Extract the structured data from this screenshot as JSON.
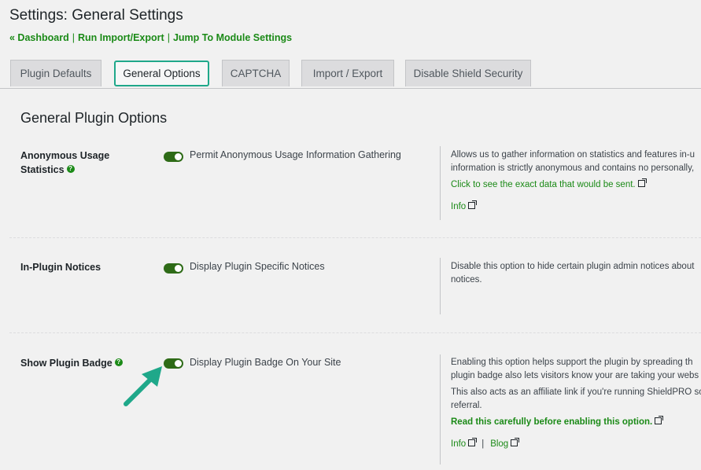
{
  "header": {
    "title": "Settings: General Settings",
    "links": [
      "« Dashboard",
      "Run Import/Export",
      "Jump To Module Settings"
    ],
    "link_sep": "|"
  },
  "tabs": [
    {
      "label": "Plugin Defaults",
      "active": false
    },
    {
      "label": "General Options",
      "active": true
    },
    {
      "label": "CAPTCHA",
      "active": false
    },
    {
      "label": "Import / Export",
      "active": false
    },
    {
      "label": "Disable Shield Security",
      "active": false
    }
  ],
  "section": {
    "title": "General Plugin Options"
  },
  "options": [
    {
      "label_line1": "Anonymous Usage",
      "label_line2": "Statistics",
      "has_help": true,
      "toggle_label": "Permit Anonymous Usage Information Gathering",
      "enabled": true,
      "desc_lines": [
        "Allows us to gather information on statistics and features in-u",
        "information is strictly anonymous and contains no personally,"
      ],
      "link": "Click to see the exact data that would be sent.",
      "links": [
        "Info"
      ]
    },
    {
      "label_line1": "In-Plugin Notices",
      "has_help": false,
      "toggle_label": "Display Plugin Specific Notices",
      "enabled": true,
      "desc_lines": [
        "Disable this option to hide certain plugin admin notices about",
        "notices."
      ]
    },
    {
      "label_line1": "Show Plugin Badge",
      "has_help": true,
      "toggle_label": "Display Plugin Badge On Your Site",
      "enabled": true,
      "desc_lines": [
        "Enabling this option helps support the plugin by spreading th",
        "plugin badge also lets visitors know your are taking your webs",
        "This also acts as an affiliate link if you're running ShieldPRO sc",
        "referral."
      ],
      "link": "Read this carefully before enabling this option.",
      "links": [
        "Info",
        "Blog"
      ],
      "links_sep": "|"
    }
  ],
  "colors": {
    "accent": "#1b8a17",
    "toggle": "#2e6b17",
    "tab_highlight": "#1fa88a",
    "background": "#f1f1f1"
  }
}
